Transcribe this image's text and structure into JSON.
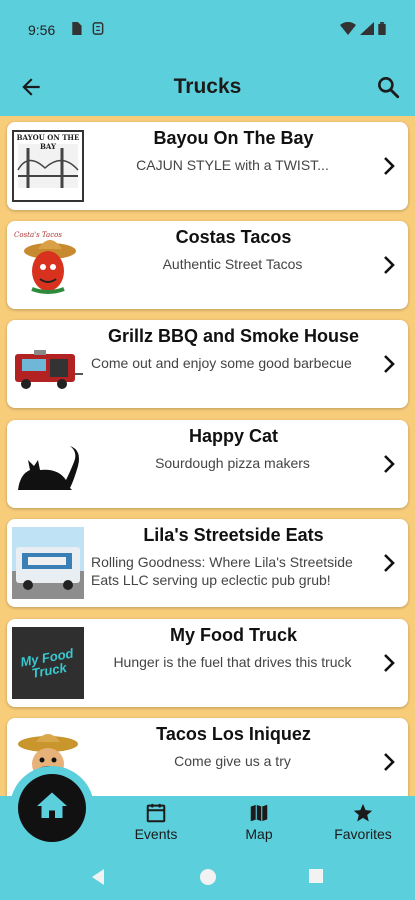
{
  "status": {
    "time": "9:56"
  },
  "appbar": {
    "title": "Trucks"
  },
  "trucks": [
    {
      "name": "Bayou On The Bay",
      "description": "CAJUN STYLE with a TWIST..."
    },
    {
      "name": "Costas Tacos",
      "description": "Authentic Street Tacos"
    },
    {
      "name": "Grillz BBQ and Smoke House",
      "description": "Come out and enjoy some good barbecue"
    },
    {
      "name": "Happy Cat",
      "description": "Sourdough pizza makers"
    },
    {
      "name": "Lila's Streetside Eats",
      "description": "Rolling Goodness: Where Lila's Streetside Eats LLC serving up eclectic pub grub!"
    },
    {
      "name": "My Food Truck",
      "description": "Hunger is the fuel that drives this truck"
    },
    {
      "name": "Tacos Los Iniquez",
      "description": "Come give us a try"
    }
  ],
  "logos": {
    "bayou": "BAYOU ON THE BAY",
    "costas": "Costa's Tacos",
    "myfood": "My Food Truck"
  },
  "bottom_nav": {
    "events": "Events",
    "map": "Map",
    "favorites": "Favorites"
  },
  "colors": {
    "teal": "#5ccfdc",
    "background": "#f8cd7a"
  },
  "icons": [
    "home-icon",
    "calendar-icon",
    "map-icon",
    "star-icon",
    "search-icon",
    "back-arrow-icon",
    "chevron-right-icon"
  ]
}
